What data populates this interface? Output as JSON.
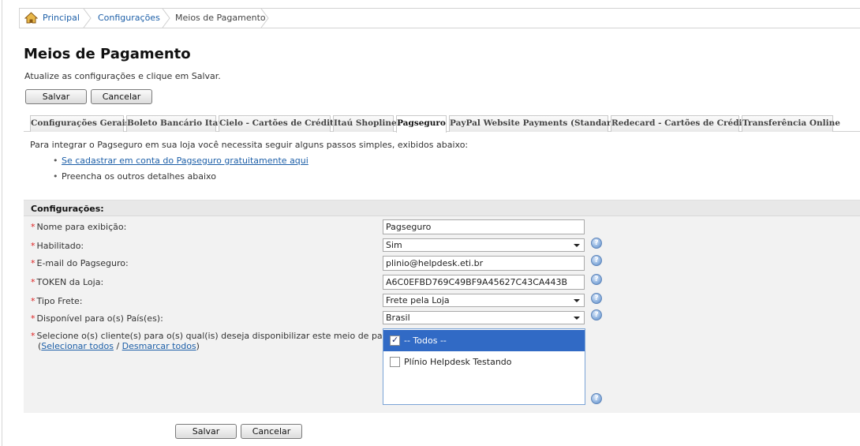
{
  "breadcrumb": {
    "items": [
      {
        "label": "Principal"
      },
      {
        "label": "Configurações"
      },
      {
        "label": "Meios de Pagamento"
      }
    ]
  },
  "page": {
    "title": "Meios de Pagamento",
    "subtitle": "Atualize as configurações e clique em Salvar."
  },
  "buttons": {
    "save": "Salvar",
    "cancel": "Cancelar"
  },
  "tabs": [
    {
      "label": "Configurações Gerais"
    },
    {
      "label": "Boleto Bancário Itaú"
    },
    {
      "label": "Cielo - Cartões de Crédito"
    },
    {
      "label": "Itaú Shopline"
    },
    {
      "label": "Pagseguro",
      "active": true
    },
    {
      "label": "PayPal Website Payments (Standard)"
    },
    {
      "label": "Redecard - Cartões de Crédito"
    },
    {
      "label": "Transferência Online"
    }
  ],
  "intro": {
    "text": "Para integrar o Pagseguro em sua loja você necessita seguir alguns passos simples, exibidos abaixo:",
    "bullets": [
      "Se cadastrar em conta do Pagseguro gratuitamente aqui",
      "Preencha os outros detalhes abaixo"
    ]
  },
  "config": {
    "header": "Configurações:",
    "required_mark": "*",
    "fields": [
      {
        "label": "Nome para exibição:",
        "value": "Pagseguro"
      },
      {
        "label": "Habilitado:",
        "value": "Sim"
      },
      {
        "label": "E-mail do Pagseguro:",
        "value": "plinio@helpdesk.eti.br"
      },
      {
        "label": "TOKEN da Loja:",
        "value": "A6C0EFBD769C49BF9A45627C43CA443B"
      },
      {
        "label": "Tipo Frete:",
        "value": "Frete pela Loja"
      },
      {
        "label": "Disponível para o(s) País(es):",
        "value": "Brasil"
      }
    ],
    "customers": {
      "label": "Selecione o(s) cliente(s) para o(s) qual(is) deseja disponibilizar este meio de pagamento.:",
      "select_all": "Selecionar todos",
      "separator": "/",
      "deselect_all": "Desmarcar todos",
      "paren_open": "(",
      "paren_close": ")",
      "options": [
        {
          "label": "-- Todos --",
          "checked": true
        },
        {
          "label": "Plínio Helpdesk Testando",
          "checked": false
        }
      ]
    },
    "help_glyph": "?"
  },
  "colors": {
    "link": "#1d5fa8",
    "selection": "#316ac5",
    "required": "#dd2222"
  },
  "icons": {
    "home": "home-icon",
    "help": "help-icon"
  }
}
